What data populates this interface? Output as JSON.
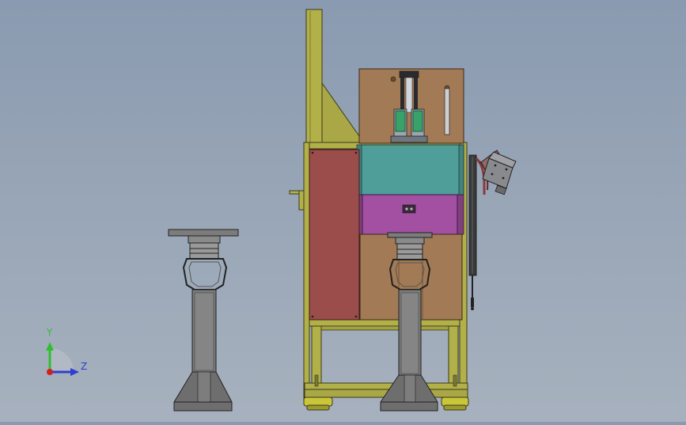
{
  "triad": {
    "y_label": "Y",
    "z_label": "Z",
    "colors": {
      "y": "#2fbf2f",
      "z": "#2e3fd0",
      "origin": "#d02020"
    }
  },
  "palette": {
    "frame": "#b2b048",
    "frame_dark": "#6f6d22",
    "back_panel": "#a27a55",
    "teal_block": "#4f9e99",
    "magenta_block": "#a350a3",
    "red_panel": "#9a4d4a",
    "lower_panel": "#a27a55",
    "column": "#7a7a7a",
    "gray_dark": "#4a4a4a",
    "box_side": "#8f6a6a",
    "bluegray_box": "#888a8e",
    "cylinder_green": "#39a26a",
    "cylinder_gray": "#9aa6b0"
  }
}
